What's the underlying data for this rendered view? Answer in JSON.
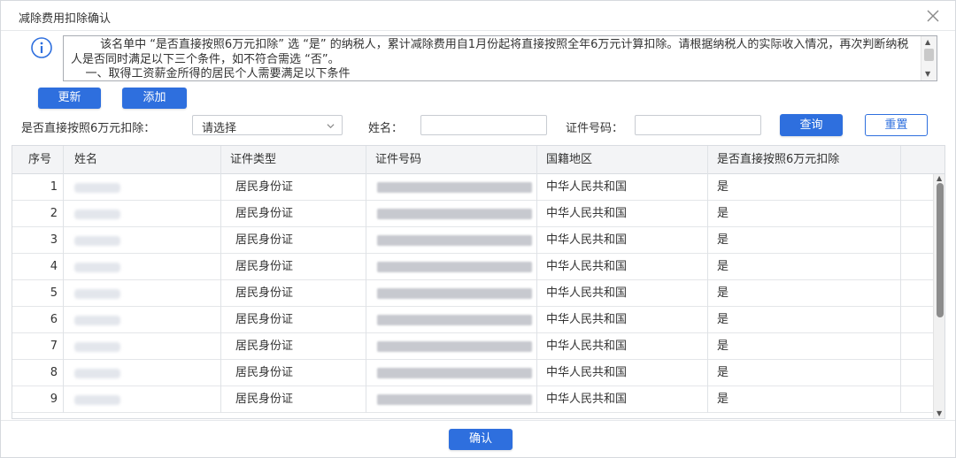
{
  "dialog": {
    "title": "减除费用扣除确认",
    "notice": "        该名单中 “是否直接按照6万元扣除” 选 “是” 的纳税人，累计减除费用自1月份起将直接按照全年6万元计算扣除。请根据纳税人的实际收入情况，再次判断纳税人是否同时满足以下三个条件，如不符合需选 “否”。\n    一、取得工资薪金所得的居民个人需要满足以下条件",
    "confirm_label": "确认"
  },
  "toolbar": {
    "update_label": "更新",
    "add_label": "添加"
  },
  "filters": {
    "direct_label": "是否直接按照6万元扣除：",
    "direct_value": "请选择",
    "name_label": "姓名：",
    "name_value": "",
    "id_label": "证件号码：",
    "id_value": "",
    "query_label": "查询",
    "reset_label": "重置"
  },
  "table": {
    "columns": [
      "序号",
      "姓名",
      "证件类型",
      "证件号码",
      "国籍地区",
      "是否直接按照6万元扣除"
    ],
    "rows": [
      {
        "no": "1",
        "id_type": "居民身份证",
        "region": "中华人民共和国",
        "direct": "是"
      },
      {
        "no": "2",
        "id_type": "居民身份证",
        "region": "中华人民共和国",
        "direct": "是"
      },
      {
        "no": "3",
        "id_type": "居民身份证",
        "region": "中华人民共和国",
        "direct": "是"
      },
      {
        "no": "4",
        "id_type": "居民身份证",
        "region": "中华人民共和国",
        "direct": "是"
      },
      {
        "no": "5",
        "id_type": "居民身份证",
        "region": "中华人民共和国",
        "direct": "是"
      },
      {
        "no": "6",
        "id_type": "居民身份证",
        "region": "中华人民共和国",
        "direct": "是"
      },
      {
        "no": "7",
        "id_type": "居民身份证",
        "region": "中华人民共和国",
        "direct": "是"
      },
      {
        "no": "8",
        "id_type": "居民身份证",
        "region": "中华人民共和国",
        "direct": "是"
      },
      {
        "no": "9",
        "id_type": "居民身份证",
        "region": "中华人民共和国",
        "direct": "是"
      }
    ]
  },
  "icons": {
    "info": "info-icon",
    "close": "close-icon",
    "dropdown": "chevron-down-icon"
  },
  "colors": {
    "primary": "#2e6fde",
    "header_bg": "#f3f4f6"
  }
}
